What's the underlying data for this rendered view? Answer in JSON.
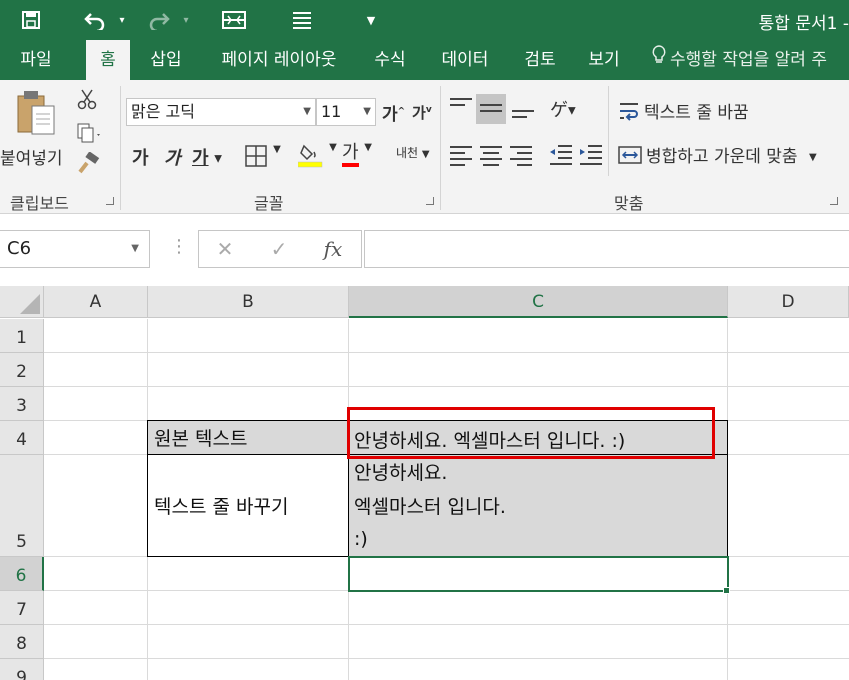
{
  "titlebar": {
    "title": "통합 문서1 -",
    "icons": [
      "save-icon",
      "undo-icon",
      "redo-icon",
      "form-icon",
      "list-icon",
      "customize-icon"
    ]
  },
  "tabs": [
    {
      "label": "파일",
      "active": false
    },
    {
      "label": "홈",
      "active": true
    },
    {
      "label": "삽입",
      "active": false
    },
    {
      "label": "페이지 레이아웃",
      "active": false
    },
    {
      "label": "수식",
      "active": false
    },
    {
      "label": "데이터",
      "active": false
    },
    {
      "label": "검토",
      "active": false
    },
    {
      "label": "보기",
      "active": false
    }
  ],
  "tellme": "수행할 작업을 알려 주",
  "clipboard": {
    "paste_label": "붙여넣기",
    "group_label": "클립보드"
  },
  "font": {
    "font_name": "맑은 고딕",
    "font_size": "11",
    "grow_label": "가",
    "shrink_label": "가",
    "bold_label": "가",
    "italic_label": "가",
    "underline_label": "가",
    "font_color_label": "가",
    "phonetic_label": "내천",
    "group_label": "글꼴",
    "font_color_accent": "#ff0000"
  },
  "alignment": {
    "wrap_text_label": "텍스트 줄 바꿈",
    "merge_center_label": "병합하고 가운데 맞춤",
    "group_label": "맞춤"
  },
  "formula_bar": {
    "name_box": "C6",
    "cancel_symbol": "✕",
    "enter_symbol": "✓",
    "fx_label": "fx",
    "formula_value": ""
  },
  "sheet": {
    "columns": [
      "A",
      "B",
      "C",
      "D"
    ],
    "rows": [
      "1",
      "2",
      "3",
      "4",
      "5",
      "6",
      "7",
      "8",
      "9"
    ],
    "selected_cell": "C6",
    "b4": "원본 텍스트",
    "c4": "안녕하세요. 엑셀마스터 입니다. :)",
    "b5": "텍스트 줄 바꾸기",
    "c5_lines": [
      "안녕하세요.",
      "엑셀마스터 입니다.",
      ":)"
    ],
    "highlight_color": "#e00000",
    "accent_color": "#217346"
  }
}
